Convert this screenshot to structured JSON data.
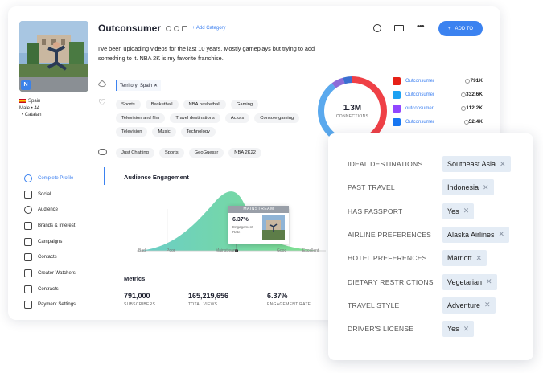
{
  "profile": {
    "name": "Outconsumer",
    "add_category": "+ Add Category",
    "bio": "I've been uploading videos for the last 10 years. Mostly gameplays but trying to add something to it. NBA 2K is my favorite franchise.",
    "avatar_badge": "N",
    "country": "Spain",
    "gender_age": "Male  •  44",
    "language": "•  Catalan"
  },
  "header": {
    "add_button": "ADD TO",
    "add_icon": "+"
  },
  "territory": "Territory: Spain",
  "interests": [
    "Sports",
    "Basketball",
    "NBA basketball",
    "Gaming",
    "Television and film",
    "Travel destinations",
    "Actors",
    "Console gaming",
    "Television",
    "Music",
    "Technology"
  ],
  "games": [
    "Just Chatting",
    "Sports",
    "GeoGuessr",
    "NBA 2K22"
  ],
  "connections": {
    "value": "1.3M",
    "label": "CONNECTIONS"
  },
  "socials": [
    {
      "platform": "youtube-icon",
      "name": "Outconsumer",
      "count": "791K",
      "color": "#e62117"
    },
    {
      "platform": "twitter-icon",
      "name": "Outconsumer",
      "count": "332.6K",
      "color": "#1da1f2"
    },
    {
      "platform": "twitch-icon",
      "name": "outconsumer",
      "count": "112.2K",
      "color": "#9146ff"
    },
    {
      "platform": "facebook-icon",
      "name": "Outconsumer",
      "count": "52.4K",
      "color": "#1877f2"
    }
  ],
  "sidebar": [
    {
      "label": "Complete Profile",
      "icon": "user-icon",
      "active": true
    },
    {
      "label": "Social",
      "icon": "chart-icon"
    },
    {
      "label": "Audience",
      "icon": "audience-icon"
    },
    {
      "label": "Brands & Interest",
      "icon": "heart-icon"
    },
    {
      "label": "Campaigns",
      "icon": "megaphone-icon"
    },
    {
      "label": "Contacts",
      "icon": "contacts-icon"
    },
    {
      "label": "Creator Watchers",
      "icon": "watchers-icon"
    },
    {
      "label": "Contracts",
      "icon": "contract-icon"
    },
    {
      "label": "Payment Settings",
      "icon": "payment-icon"
    }
  ],
  "audience": {
    "title": "Audience Engagement",
    "axis": [
      "Bad",
      "Poor",
      "Mainstream",
      "Good",
      "Excellent"
    ],
    "tooltip": {
      "header": "MAINSTREAM",
      "value": "6.37%",
      "label": "Engagement Rate"
    }
  },
  "metrics": {
    "title": "Metrics",
    "items": [
      {
        "value": "791,000",
        "label": "SUBSCRIBERS"
      },
      {
        "value": "165,219,656",
        "label": "TOTAL VIEWS"
      },
      {
        "value": "6.37%",
        "label": "ENGAGEMENT RATE"
      }
    ]
  },
  "preferences": [
    {
      "label": "IDEAL DESTINATIONS",
      "value": "Southeast Asia"
    },
    {
      "label": "PAST TRAVEL",
      "value": "Indonesia"
    },
    {
      "label": "HAS PASSPORT",
      "value": "Yes"
    },
    {
      "label": "AIRLINE PREFERENCES",
      "value": "Alaska Airlines"
    },
    {
      "label": "HOTEL PREFERENCES",
      "value": "Marriott"
    },
    {
      "label": "DIETARY RESTRICTIONS",
      "value": "Vegetarian"
    },
    {
      "label": "TRAVEL STYLE",
      "value": "Adventure"
    },
    {
      "label": "DRIVER'S LICENSE",
      "value": "Yes"
    }
  ],
  "colors": {
    "accent": "#3b82f0",
    "chart_gradient_start": "#5ec8c4",
    "chart_gradient_end": "#7de38a"
  }
}
